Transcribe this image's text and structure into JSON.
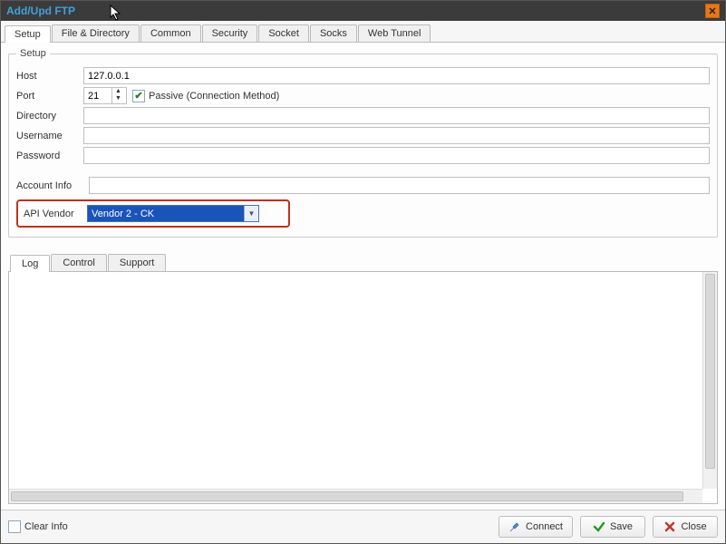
{
  "window": {
    "title": "Add/Upd FTP"
  },
  "tabs": {
    "items": [
      {
        "label": "Setup"
      },
      {
        "label": "File & Directory"
      },
      {
        "label": "Common"
      },
      {
        "label": "Security"
      },
      {
        "label": "Socket"
      },
      {
        "label": "Socks"
      },
      {
        "label": "Web Tunnel"
      }
    ],
    "active": 0
  },
  "setup": {
    "legend": "Setup",
    "labels": {
      "host": "Host",
      "port": "Port",
      "directory": "Directory",
      "username": "Username",
      "password": "Password",
      "accountInfo": "Account Info",
      "apiVendor": "API Vendor"
    },
    "values": {
      "host": "127.0.0.1",
      "port": "21",
      "directory": "",
      "username": "",
      "password": "",
      "accountInfo": "",
      "apiVendor": "Vendor 2 - CK"
    },
    "passive": {
      "checked": true,
      "label": "Passive (Connection Method)"
    }
  },
  "subTabs": {
    "items": [
      {
        "label": "Log"
      },
      {
        "label": "Control"
      },
      {
        "label": "Support"
      }
    ],
    "active": 0
  },
  "bottom": {
    "clearInfo": {
      "label": "Clear Info",
      "checked": false
    },
    "buttons": {
      "connect": "Connect",
      "save": "Save",
      "close": "Close"
    }
  }
}
